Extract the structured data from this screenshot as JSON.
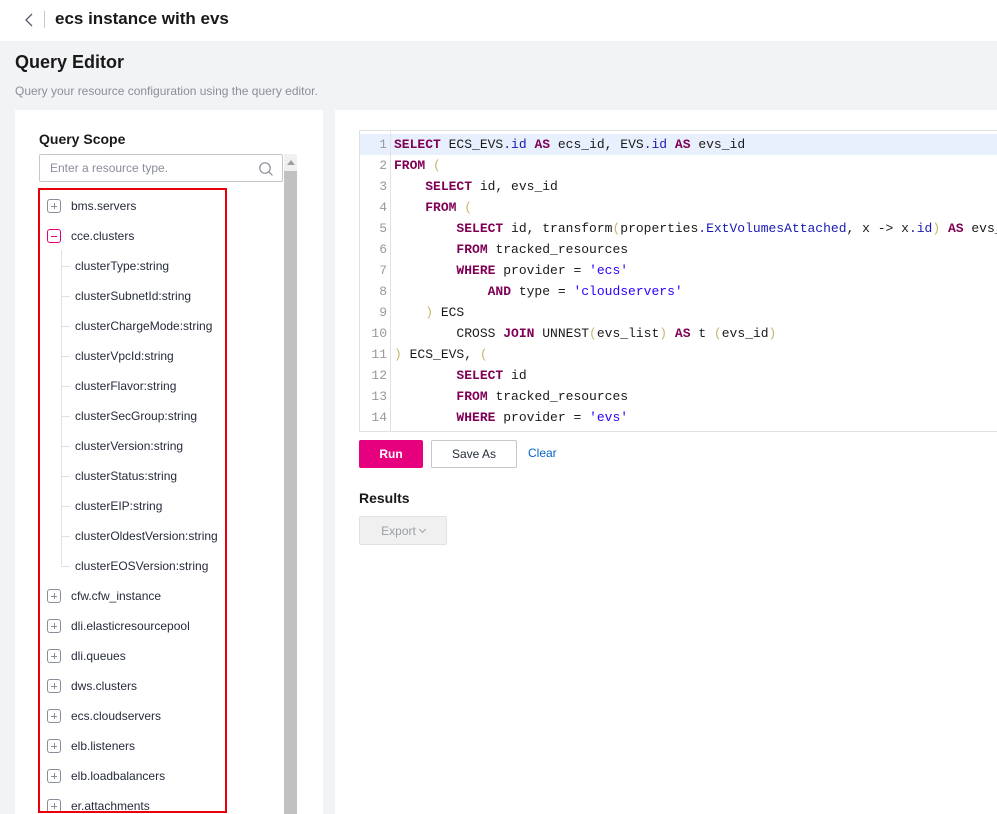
{
  "header": {
    "back_icon": "chevron-left-icon",
    "title": "ecs instance with evs"
  },
  "page": {
    "title": "Query Editor",
    "description": "Query your resource configuration using the query editor."
  },
  "query_scope": {
    "title": "Query Scope",
    "search_placeholder": "Enter a resource type.",
    "search_icon": "search-icon",
    "tree": [
      {
        "label": "bms.servers",
        "expanded": false
      },
      {
        "label": "cce.clusters",
        "expanded": true,
        "children": [
          "clusterType:string",
          "clusterSubnetId:string",
          "clusterChargeMode:string",
          "clusterVpcId:string",
          "clusterFlavor:string",
          "clusterSecGroup:string",
          "clusterVersion:string",
          "clusterStatus:string",
          "clusterEIP:string",
          "clusterOldestVersion:string",
          "clusterEOSVersion:string"
        ]
      },
      {
        "label": "cfw.cfw_instance",
        "expanded": false
      },
      {
        "label": "dli.elasticresourcepool",
        "expanded": false
      },
      {
        "label": "dli.queues",
        "expanded": false
      },
      {
        "label": "dws.clusters",
        "expanded": false
      },
      {
        "label": "ecs.cloudservers",
        "expanded": false
      },
      {
        "label": "elb.listeners",
        "expanded": false
      },
      {
        "label": "elb.loadbalancers",
        "expanded": false
      },
      {
        "label": "er.attachments",
        "expanded": false
      }
    ]
  },
  "editor": {
    "active_line": 1,
    "lines": [
      [
        [
          "kw",
          "SELECT"
        ],
        [
          "t",
          " ECS_EVS"
        ],
        [
          "fld",
          ".id"
        ],
        [
          "t",
          " "
        ],
        [
          "kw",
          "AS"
        ],
        [
          "t",
          " ecs_id, EVS"
        ],
        [
          "fld",
          ".id"
        ],
        [
          "t",
          " "
        ],
        [
          "kw",
          "AS"
        ],
        [
          "t",
          " evs_id"
        ]
      ],
      [
        [
          "kw",
          "FROM"
        ],
        [
          "t",
          " "
        ],
        [
          "par",
          "("
        ]
      ],
      [
        [
          "t",
          "    "
        ],
        [
          "kw",
          "SELECT"
        ],
        [
          "t",
          " id, evs_id"
        ]
      ],
      [
        [
          "t",
          "    "
        ],
        [
          "kw",
          "FROM"
        ],
        [
          "t",
          " "
        ],
        [
          "par",
          "("
        ]
      ],
      [
        [
          "t",
          "        "
        ],
        [
          "kw",
          "SELECT"
        ],
        [
          "t",
          " id, transform"
        ],
        [
          "par",
          "("
        ],
        [
          "t",
          "properties"
        ],
        [
          "fld",
          ".ExtVolumesAttached"
        ],
        [
          "t",
          ", x -> x"
        ],
        [
          "fld",
          ".id"
        ],
        [
          "par",
          ")"
        ],
        [
          "t",
          " "
        ],
        [
          "kw",
          "AS"
        ],
        [
          "t",
          " evs_list"
        ]
      ],
      [
        [
          "t",
          "        "
        ],
        [
          "kw",
          "FROM"
        ],
        [
          "t",
          " tracked_resources"
        ]
      ],
      [
        [
          "t",
          "        "
        ],
        [
          "kw",
          "WHERE"
        ],
        [
          "t",
          " provider = "
        ],
        [
          "str",
          "'ecs'"
        ]
      ],
      [
        [
          "t",
          "            "
        ],
        [
          "kw",
          "AND"
        ],
        [
          "t",
          " type = "
        ],
        [
          "str",
          "'cloudservers'"
        ]
      ],
      [
        [
          "t",
          "    "
        ],
        [
          "par",
          ")"
        ],
        [
          "t",
          " ECS"
        ]
      ],
      [
        [
          "t",
          "        CROSS "
        ],
        [
          "kw",
          "JOIN"
        ],
        [
          "t",
          " UNNEST"
        ],
        [
          "par",
          "("
        ],
        [
          "t",
          "evs_list"
        ],
        [
          "par",
          ")"
        ],
        [
          "t",
          " "
        ],
        [
          "kw",
          "AS"
        ],
        [
          "t",
          " t "
        ],
        [
          "par",
          "("
        ],
        [
          "t",
          "evs_id"
        ],
        [
          "par",
          ")"
        ]
      ],
      [
        [
          "par",
          ")"
        ],
        [
          "t",
          " ECS_EVS, "
        ],
        [
          "par",
          "("
        ]
      ],
      [
        [
          "t",
          "        "
        ],
        [
          "kw",
          "SELECT"
        ],
        [
          "t",
          " id"
        ]
      ],
      [
        [
          "t",
          "        "
        ],
        [
          "kw",
          "FROM"
        ],
        [
          "t",
          " tracked_resources"
        ]
      ],
      [
        [
          "t",
          "        "
        ],
        [
          "kw",
          "WHERE"
        ],
        [
          "t",
          " provider = "
        ],
        [
          "str",
          "'evs'"
        ]
      ]
    ]
  },
  "actions": {
    "run": "Run",
    "save_as": "Save As",
    "clear": "Clear"
  },
  "results": {
    "title": "Results",
    "export": "Export"
  },
  "colors": {
    "accent": "#e6007e",
    "highlight_border": "#e8000b",
    "link": "#0066cc"
  }
}
